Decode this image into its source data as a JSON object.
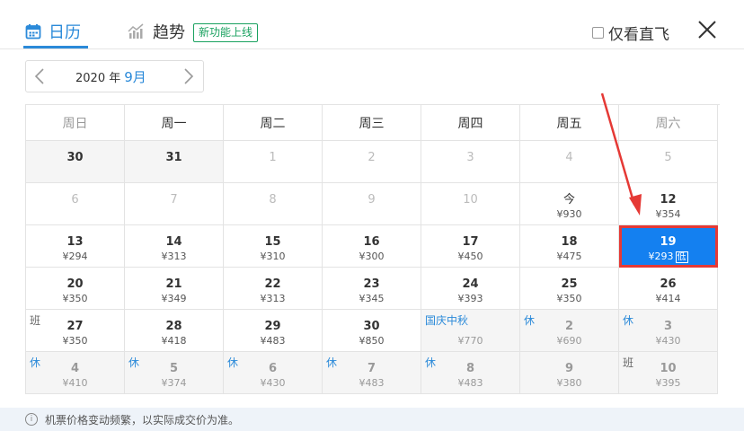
{
  "tabs": {
    "calendar": "日历",
    "trend": "趋势",
    "new_badge": "新功能上线"
  },
  "direct_only": "仅看直飞",
  "month_selector": {
    "year": "2020 年",
    "month": "9月"
  },
  "weekdays": [
    "周日",
    "周一",
    "周二",
    "周三",
    "周四",
    "周五",
    "周六"
  ],
  "rows": [
    [
      {
        "day": "30",
        "price": "",
        "state": "gray"
      },
      {
        "day": "31",
        "price": "",
        "state": "gray"
      },
      {
        "day": "1",
        "price": "",
        "state": "off"
      },
      {
        "day": "2",
        "price": "",
        "state": "off"
      },
      {
        "day": "3",
        "price": "",
        "state": "off"
      },
      {
        "day": "4",
        "price": "",
        "state": "off"
      },
      {
        "day": "5",
        "price": "",
        "state": "off"
      }
    ],
    [
      {
        "day": "6",
        "price": "",
        "state": "off"
      },
      {
        "day": "7",
        "price": "",
        "state": "off"
      },
      {
        "day": "8",
        "price": "",
        "state": "off"
      },
      {
        "day": "9",
        "price": "",
        "state": "off"
      },
      {
        "day": "10",
        "price": "",
        "state": "off"
      },
      {
        "day": "今",
        "price": "¥930",
        "state": "today"
      },
      {
        "day": "12",
        "price": "¥354",
        "state": ""
      }
    ],
    [
      {
        "day": "13",
        "price": "¥294",
        "state": ""
      },
      {
        "day": "14",
        "price": "¥313",
        "state": ""
      },
      {
        "day": "15",
        "price": "¥310",
        "state": ""
      },
      {
        "day": "16",
        "price": "¥300",
        "state": ""
      },
      {
        "day": "17",
        "price": "¥450",
        "state": ""
      },
      {
        "day": "18",
        "price": "¥475",
        "state": ""
      },
      {
        "day": "19",
        "price": "¥293",
        "state": "selected",
        "tag": "低"
      }
    ],
    [
      {
        "day": "20",
        "price": "¥350",
        "state": ""
      },
      {
        "day": "21",
        "price": "¥349",
        "state": ""
      },
      {
        "day": "22",
        "price": "¥313",
        "state": ""
      },
      {
        "day": "23",
        "price": "¥345",
        "state": ""
      },
      {
        "day": "24",
        "price": "¥393",
        "state": ""
      },
      {
        "day": "25",
        "price": "¥350",
        "state": ""
      },
      {
        "day": "26",
        "price": "¥414",
        "state": ""
      }
    ],
    [
      {
        "day": "27",
        "price": "¥350",
        "state": "",
        "holiday": "班",
        "holiday_type": "ban"
      },
      {
        "day": "28",
        "price": "¥418",
        "state": ""
      },
      {
        "day": "29",
        "price": "¥483",
        "state": ""
      },
      {
        "day": "30",
        "price": "¥850",
        "state": ""
      },
      {
        "day": "",
        "price": "¥770",
        "state": "dim gray",
        "holiday": "国庆中秋",
        "holiday_type": "festival"
      },
      {
        "day": "2",
        "price": "¥690",
        "state": "dim gray",
        "holiday": "休",
        "holiday_type": "rest"
      },
      {
        "day": "3",
        "price": "¥430",
        "state": "dim gray",
        "holiday": "休",
        "holiday_type": "rest"
      }
    ],
    [
      {
        "day": "4",
        "price": "¥410",
        "state": "dim gray",
        "holiday": "休",
        "holiday_type": "rest"
      },
      {
        "day": "5",
        "price": "¥374",
        "state": "dim gray",
        "holiday": "休",
        "holiday_type": "rest"
      },
      {
        "day": "6",
        "price": "¥430",
        "state": "dim gray",
        "holiday": "休",
        "holiday_type": "rest"
      },
      {
        "day": "7",
        "price": "¥483",
        "state": "dim gray",
        "holiday": "休",
        "holiday_type": "rest"
      },
      {
        "day": "8",
        "price": "¥483",
        "state": "dim gray",
        "holiday": "休",
        "holiday_type": "rest"
      },
      {
        "day": "9",
        "price": "¥380",
        "state": "dim gray"
      },
      {
        "day": "10",
        "price": "¥395",
        "state": "dim gray",
        "holiday": "班",
        "holiday_type": "ban"
      }
    ]
  ],
  "footer_note": "机票价格变动频繁，以实际成交价为准。",
  "colors": {
    "accent": "#2b8ad9",
    "selected": "#1480f0",
    "highlight": "#e53935",
    "badge": "#19a15f"
  }
}
